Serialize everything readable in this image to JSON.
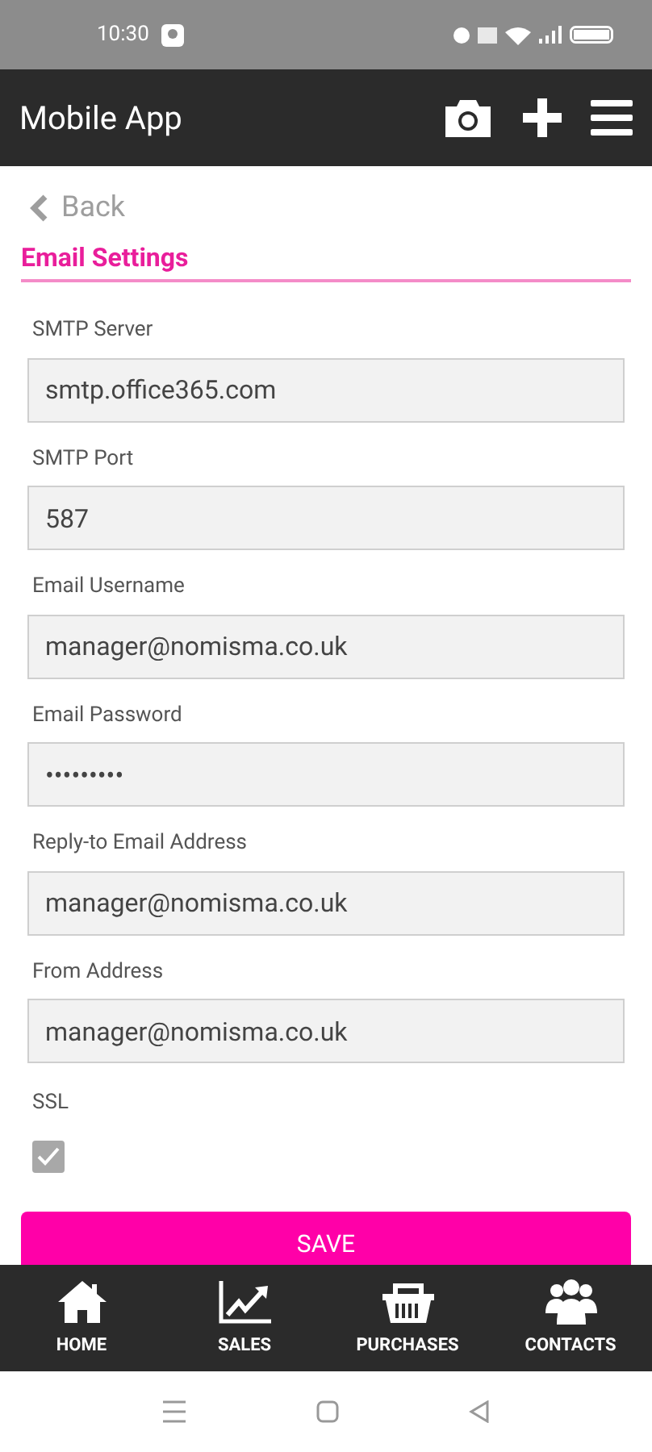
{
  "status_bar": {
    "time": "10:30"
  },
  "header": {
    "title": "Mobile App"
  },
  "back": {
    "label": "Back"
  },
  "section": {
    "title": "Email Settings"
  },
  "fields": [
    {
      "label": "SMTP Server",
      "value": "smtp.office365.com"
    },
    {
      "label": "SMTP Port",
      "value": "587"
    },
    {
      "label": "Email Username",
      "value": "manager@nomisma.co.uk"
    },
    {
      "label": "Email Password",
      "value": "•••••••••"
    },
    {
      "label": "Reply-to Email Address",
      "value": "manager@nomisma.co.uk"
    },
    {
      "label": "From Address",
      "value": "manager@nomisma.co.uk"
    }
  ],
  "ssl": {
    "label": "SSL",
    "checked": true
  },
  "save_button": {
    "label": "SAVE"
  },
  "bottom_nav": [
    {
      "kind": "home",
      "label": "HOME"
    },
    {
      "kind": "sales",
      "label": "SALES"
    },
    {
      "kind": "purchases",
      "label": "PURCHASES"
    },
    {
      "kind": "contacts",
      "label": "CONTACTS"
    }
  ]
}
